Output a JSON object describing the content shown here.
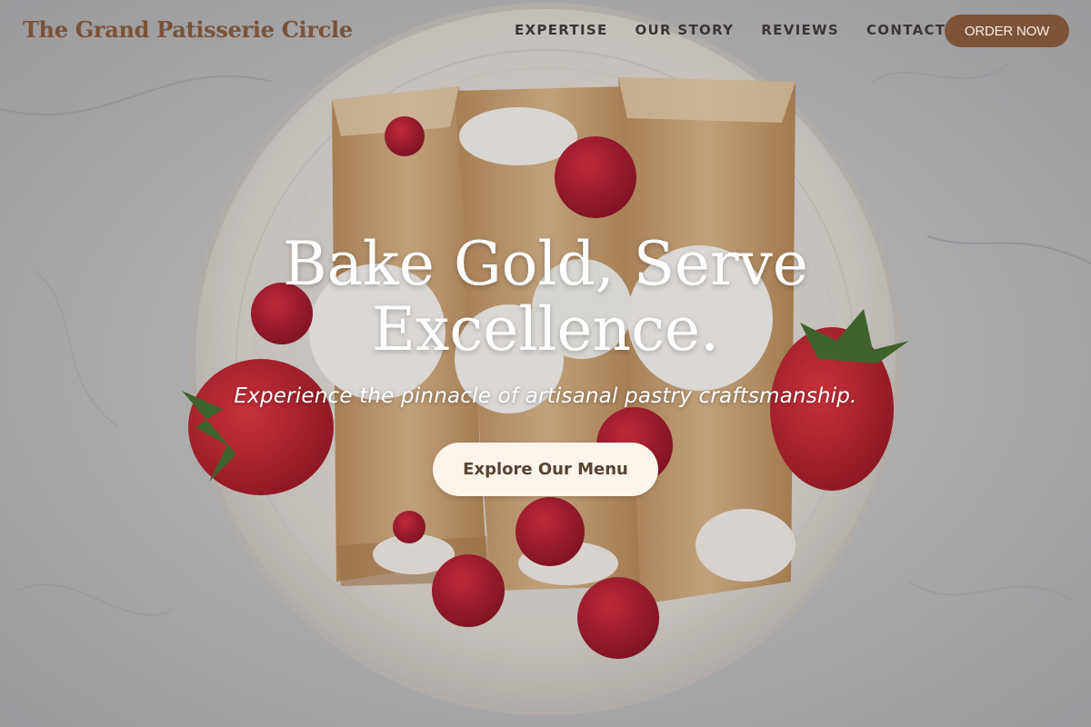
{
  "brand": {
    "name": "The Grand Patisserie Circle"
  },
  "nav": {
    "items": [
      {
        "label": "EXPERTISE"
      },
      {
        "label": "OUR STORY"
      },
      {
        "label": "REVIEWS"
      },
      {
        "label": "CONTACT"
      }
    ],
    "order_label": "ORDER NOW"
  },
  "hero": {
    "headline_line1": "Bake Gold, Serve",
    "headline_line2": "Excellence.",
    "subheadline": "Experience the pinnacle of artisanal pastry craftsmanship.",
    "cta_label": "Explore Our Menu"
  },
  "colors": {
    "brand_brown": "#7d5338",
    "logo_brown": "#7a5238",
    "nav_text": "#3b3634",
    "cta_background": "#fbf4ea",
    "cta_text": "#5a4232"
  }
}
